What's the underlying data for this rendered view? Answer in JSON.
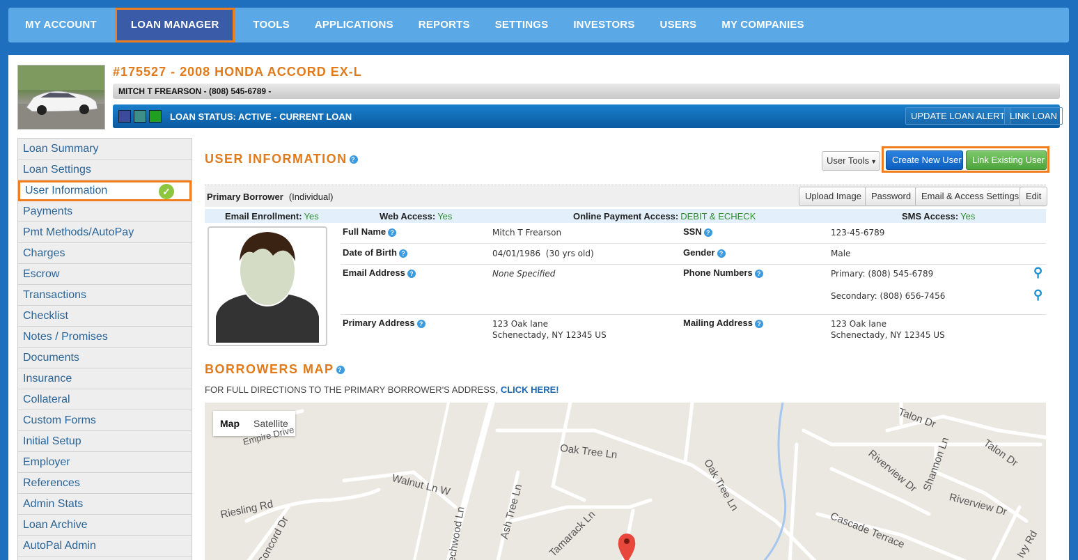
{
  "nav": [
    "MY ACCOUNT",
    "LOAN MANAGER",
    "TOOLS",
    "APPLICATIONS",
    "REPORTS",
    "SETTINGS",
    "INVESTORS",
    "USERS",
    "MY COMPANIES"
  ],
  "loan": {
    "title": "#175527 - 2008 HONDA ACCORD EX-L",
    "borrower_line": "MITCH T FREARSON - (808) 545-6789 -",
    "status": "LOAN STATUS: ACTIVE - CURRENT LOAN",
    "update_alert": "UPDATE LOAN ALERT",
    "link_loan": "LINK LOAN",
    "swatch_colors": [
      "#3b4a9b",
      "#3e8f8a",
      "#1fa01f"
    ]
  },
  "sidebar": [
    "Loan Summary",
    "Loan Settings",
    "User Information",
    "Payments",
    "Pmt Methods/AutoPay",
    "Charges",
    "Escrow",
    "Transactions",
    "Checklist",
    "Notes / Promises",
    "Documents",
    "Insurance",
    "Collateral",
    "Custom Forms",
    "Initial Setup",
    "Employer",
    "References",
    "Admin Stats",
    "Loan Archive",
    "AutoPal Admin"
  ],
  "user_info": {
    "title": "USER INFORMATION",
    "user_tools": "User Tools",
    "create_user": "Create New User",
    "link_user": "Link Existing User",
    "primary_borrower": "Primary Borrower",
    "borrower_type": "(Individual)",
    "upload_image": "Upload Image",
    "password": "Password",
    "email_access": "Email & Access Settings",
    "edit": "Edit",
    "access": {
      "email_label": "Email Enrollment:",
      "email_val": "Yes",
      "web_label": "Web Access:",
      "web_val": "Yes",
      "online_label": "Online Payment Access:",
      "online_val": "DEBIT & ECHECK",
      "sms_label": "SMS Access:",
      "sms_val": "Yes"
    },
    "full_name_label": "Full Name",
    "full_name": "Mitch T Frearson",
    "ssn_label": "SSN",
    "ssn": "123-45-6789",
    "dob_label": "Date of Birth",
    "dob": "04/01/1986  (30 yrs old)",
    "gender_label": "Gender",
    "gender": "Male",
    "email_label": "Email Address",
    "email": "None Specified",
    "phone_label": "Phone Numbers",
    "phone_primary": "Primary: (808) 545-6789",
    "phone_secondary": "Secondary: (808) 656-7456",
    "primary_addr_label": "Primary Address",
    "primary_addr_1": "123 Oak lane",
    "primary_addr_2": "Schenectady, NY 12345 US",
    "mailing_addr_label": "Mailing Address",
    "mailing_addr_1": "123 Oak lane",
    "mailing_addr_2": "Schenectady, NY 12345 US"
  },
  "map": {
    "title": "BORROWERS MAP",
    "note": "FOR FULL DIRECTIONS TO THE PRIMARY BORROWER'S ADDRESS, ",
    "link": "CLICK HERE!",
    "map_btn": "Map",
    "satellite_btn": "Satellite",
    "streets": [
      "Empire Drive",
      "Oak Tree Ln",
      "Oak Tree Ln",
      "Walnut Ln W",
      "Riesling Rd",
      "Concord Dr",
      "Ash Tree Ln",
      "Tamarack Ln",
      "Beechwood Ln",
      "Talon Dr",
      "Talon Dr",
      "Shannon Ln",
      "Riverview Dr",
      "Riverview Dr",
      "Cascade Terrace",
      "Ivy Rd"
    ]
  }
}
